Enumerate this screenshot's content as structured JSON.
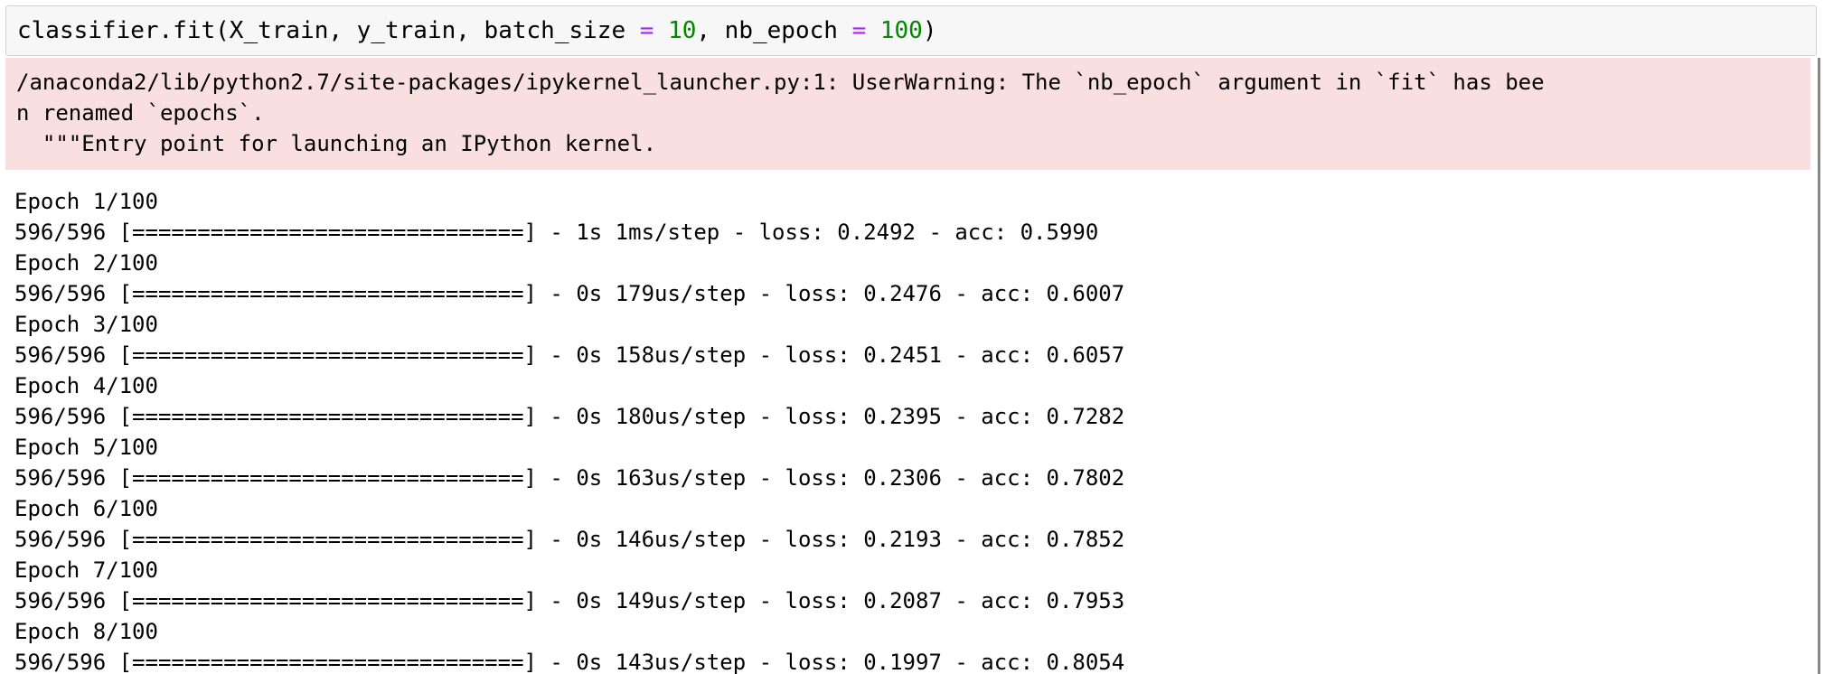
{
  "input": {
    "prefix": "classifier.fit(X_train, y_train, batch_size ",
    "op1": "=",
    "mid1": " ",
    "num1": "10",
    "mid2": ", nb_epoch ",
    "op2": "=",
    "mid3": " ",
    "num2": "100",
    "suffix": ")"
  },
  "stderr": {
    "lines": [
      "/anaconda2/lib/python2.7/site-packages/ipykernel_launcher.py:1: UserWarning: The `nb_epoch` argument in `fit` has bee",
      "n renamed `epochs`.",
      "  \"\"\"Entry point for launching an IPython kernel."
    ]
  },
  "stdout": {
    "lines": [
      "Epoch 1/100",
      "596/596 [==============================] - 1s 1ms/step - loss: 0.2492 - acc: 0.5990",
      "Epoch 2/100",
      "596/596 [==============================] - 0s 179us/step - loss: 0.2476 - acc: 0.6007",
      "Epoch 3/100",
      "596/596 [==============================] - 0s 158us/step - loss: 0.2451 - acc: 0.6057",
      "Epoch 4/100",
      "596/596 [==============================] - 0s 180us/step - loss: 0.2395 - acc: 0.7282",
      "Epoch 5/100",
      "596/596 [==============================] - 0s 163us/step - loss: 0.2306 - acc: 0.7802",
      "Epoch 6/100",
      "596/596 [==============================] - 0s 146us/step - loss: 0.2193 - acc: 0.7852",
      "Epoch 7/100",
      "596/596 [==============================] - 0s 149us/step - loss: 0.2087 - acc: 0.7953",
      "Epoch 8/100",
      "596/596 [==============================] - 0s 143us/step - loss: 0.1997 - acc: 0.8054"
    ]
  },
  "colors": {
    "input_bg": "#f7f7f7",
    "stderr_bg": "#f9dfe0",
    "operator": "#aa22ff",
    "number": "#008800"
  }
}
